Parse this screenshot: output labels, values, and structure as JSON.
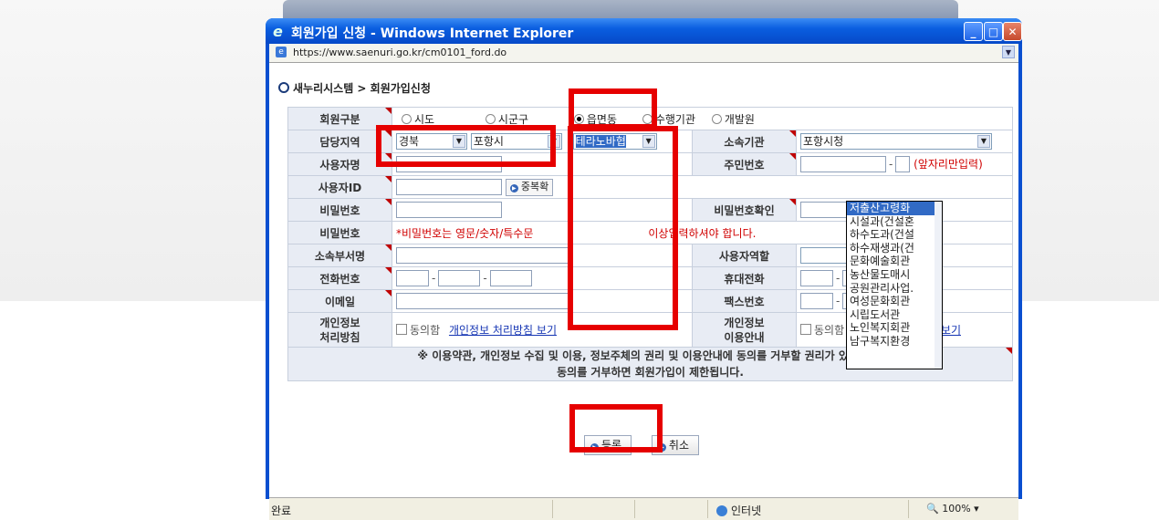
{
  "window": {
    "title": "회원가입 신청 - Windows Internet Explorer",
    "url": "https://www.saenuri.go.kr/cm0101_ford.do"
  },
  "breadcrumb": "새누리시스템 > 회원가입신청",
  "form": {
    "member_type": {
      "label": "회원구분",
      "options": [
        "시도",
        "시군구",
        "읍면동",
        "수행기관",
        "개발원"
      ],
      "selected": "읍면동"
    },
    "region": {
      "label": "담당지역",
      "province": "경북",
      "city": "포항시",
      "district": "테라노바협"
    },
    "org": {
      "label": "소속기관",
      "value": "포항시청"
    },
    "username": {
      "label": "사용자명"
    },
    "resident_no": {
      "label": "주민번호",
      "hint": "(앞자리만입력)"
    },
    "user_id": {
      "label": "사용자ID",
      "dup_check": "중복확"
    },
    "password": {
      "label": "비밀번호"
    },
    "password_confirm": {
      "label": "비밀번호확인"
    },
    "password_note": {
      "label": "비밀번호",
      "text_a": "*비밀번호는 영문/숫자/특수문",
      "text_b": "이상입력하셔야 합니다."
    },
    "department": {
      "label": "소속부서명"
    },
    "user_role": {
      "label": "사용자역할"
    },
    "phone": {
      "label": "전화번호"
    },
    "mobile": {
      "label": "휴대전화"
    },
    "email": {
      "label": "이메일"
    },
    "fax": {
      "label": "팩스번호"
    },
    "privacy_policy": {
      "label_1": "개인정보",
      "label_2": "처리방침",
      "agree": "동의함",
      "link": "개인정보 처리방침 보기"
    },
    "privacy_usage": {
      "label_1": "개인정보",
      "label_2": "이용안내",
      "agree": "동의함",
      "link": "개인정보 이용안내 보기"
    },
    "notice_1": "※ 이용약관, 개인정보 수집 및 이용, 정보주체의 권리 및 이용안내에 동의를 거부할 권리가 있습니다.",
    "notice_2": "동의를 거부하면 회원가입이 제한됩니다."
  },
  "dropdown_options": [
    "저출산고령화",
    "시설과(건설혼",
    "하수도과(건설",
    "하수재생과(건",
    "문화예술회관",
    "농산물도매시",
    "공원관리사업.",
    "여성문화회관",
    "시립도서관",
    "노인복지회관",
    "남구복지환경"
  ],
  "buttons": {
    "register": "등록",
    "cancel": "취소"
  },
  "statusbar": {
    "status": "완료",
    "zone": "인터넷",
    "zoom": "100%"
  },
  "colors": {
    "highlight": "#e60000",
    "titlebar": "#0a5ee0",
    "label_bg": "#e8ecf4"
  }
}
